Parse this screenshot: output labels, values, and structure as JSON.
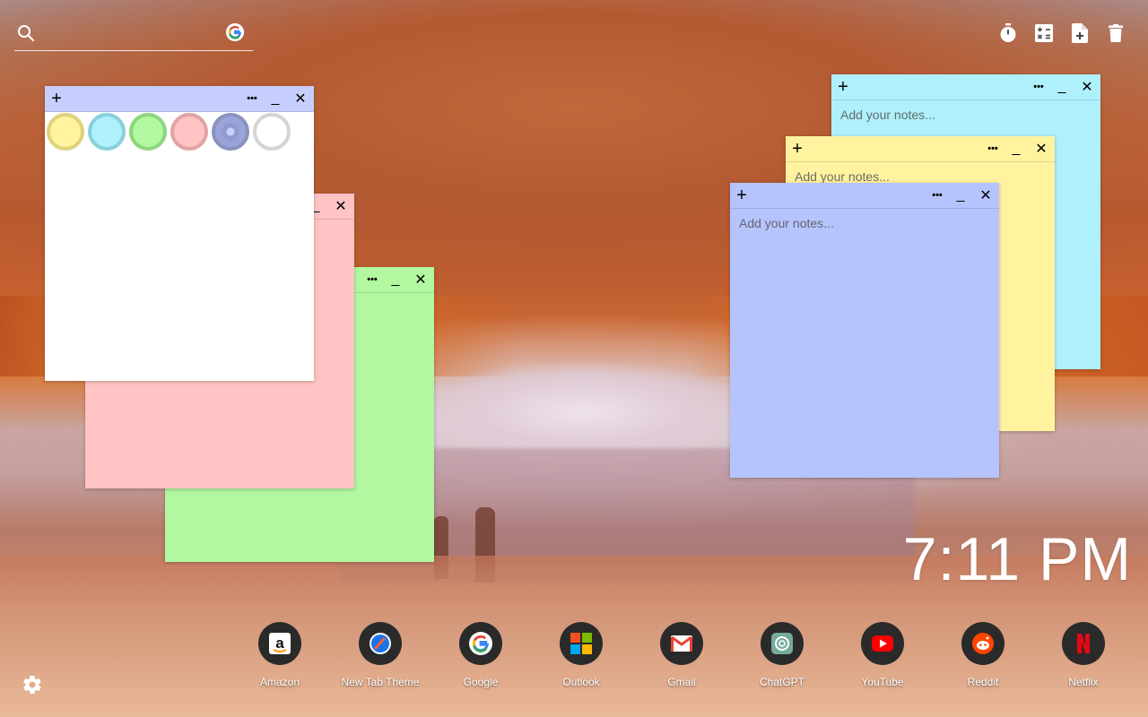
{
  "search": {
    "placeholder": ""
  },
  "top_tools": [
    {
      "name": "timer-icon"
    },
    {
      "name": "calculator-icon"
    },
    {
      "name": "new-note-icon"
    },
    {
      "name": "trash-icon"
    }
  ],
  "notes": {
    "placeholder": "Add your notes...",
    "add_symbol": "+",
    "more_symbol": "•••",
    "minimize_symbol": "_",
    "close_symbol": "✕"
  },
  "color_picker": {
    "colors": [
      "#fff3a0",
      "#aef0fb",
      "#b1f8a1",
      "#ffc3c3",
      "#b6c4fd",
      "#ffffff"
    ],
    "selected": 4
  },
  "colors": {
    "note_yellow": "#fff3a0",
    "note_cyan": "#aef0fb",
    "note_green": "#b1f8a1",
    "note_pink": "#ffc3c3",
    "note_blue": "#b6c4fd",
    "note_white": "#ffffff"
  },
  "clock": {
    "time": "7:11 PM"
  },
  "dock": {
    "apps": [
      {
        "label": "Amazon",
        "icon": "amazon-icon"
      },
      {
        "label": "New Tab Theme",
        "icon": "new-tab-theme-icon"
      },
      {
        "label": "Google",
        "icon": "google-icon"
      },
      {
        "label": "Outlook",
        "icon": "outlook-icon"
      },
      {
        "label": "Gmail",
        "icon": "gmail-icon"
      },
      {
        "label": "ChatGPT",
        "icon": "chatgpt-icon"
      },
      {
        "label": "YouTube",
        "icon": "youtube-icon"
      },
      {
        "label": "Reddit",
        "icon": "reddit-icon"
      },
      {
        "label": "Netflix",
        "icon": "netflix-icon"
      }
    ]
  }
}
